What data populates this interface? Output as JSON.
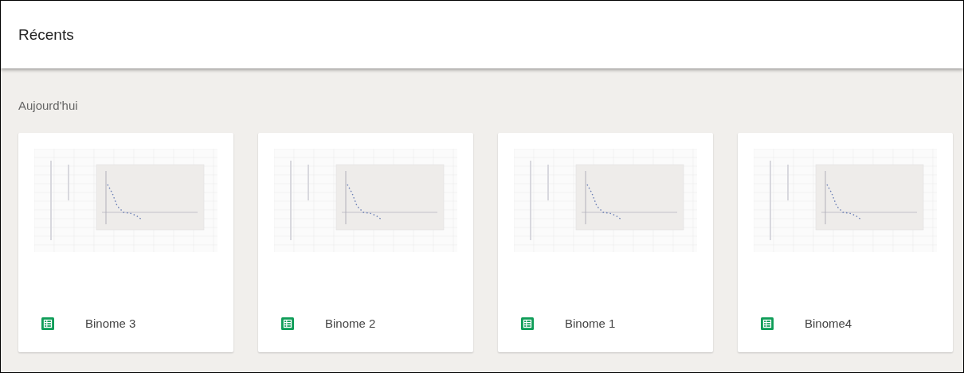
{
  "header": {
    "title": "Récents"
  },
  "section": {
    "title": "Aujourd'hui"
  },
  "files": [
    {
      "name": "Binome 3"
    },
    {
      "name": "Binome 2"
    },
    {
      "name": "Binome 1"
    },
    {
      "name": "Binome4"
    }
  ]
}
